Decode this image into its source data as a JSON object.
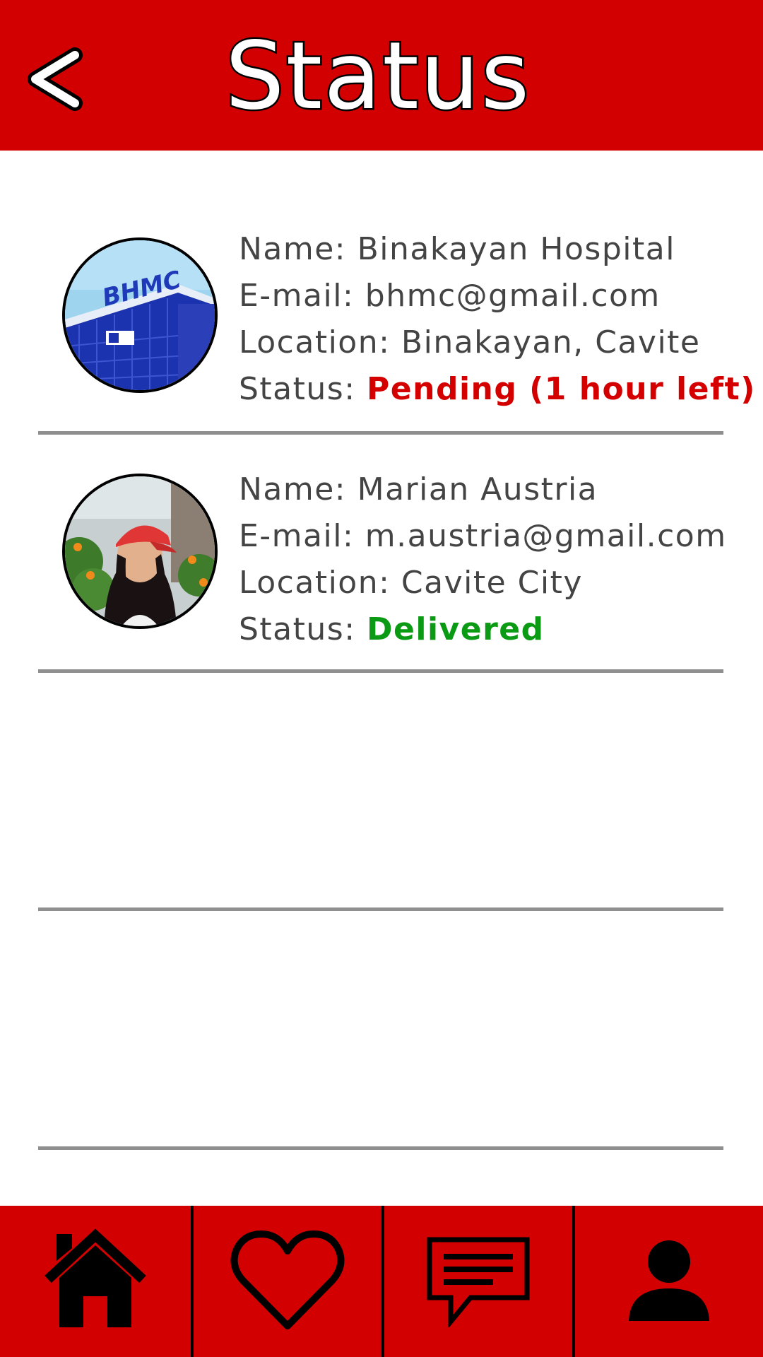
{
  "header": {
    "title": "Status",
    "back_label": "<",
    "background_color": "#d20000"
  },
  "entries": [
    {
      "avatar": "hospital-building-photo",
      "avatar_text": "BHMC",
      "name_label": "Name: ",
      "name": "Binakayan Hospital",
      "email_label": "E-mail: ",
      "email": "bhmc@gmail.com",
      "location_label": "Location: ",
      "location": "Binakayan, Cavite",
      "status_label": "Status: ",
      "status": "Pending (1 hour left)",
      "status_color": "#d40000"
    },
    {
      "avatar": "person-photo",
      "name_label": "Name: ",
      "name": "Marian Austria",
      "email_label": "E-mail: ",
      "email": "m.austria@gmail.com",
      "location_label": "Location: ",
      "location": "Cavite City",
      "status_label": "Status: ",
      "status": "Delivered",
      "status_color": "#0a9a13"
    }
  ],
  "nav": {
    "items": [
      {
        "icon": "home-icon"
      },
      {
        "icon": "heart-icon"
      },
      {
        "icon": "chat-icon"
      },
      {
        "icon": "profile-icon"
      }
    ]
  }
}
